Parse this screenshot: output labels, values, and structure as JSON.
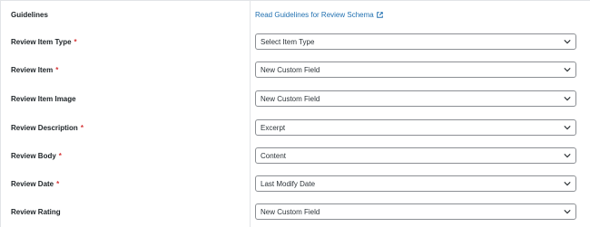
{
  "guidelines": {
    "label": "Guidelines",
    "link_text": "Read Guidelines for Review Schema",
    "link_icon": "external-link-icon"
  },
  "fields": [
    {
      "label": "Review Item Type",
      "required": true,
      "value": "Select Item Type"
    },
    {
      "label": "Review Item",
      "required": true,
      "value": "New Custom Field"
    },
    {
      "label": "Review Item Image",
      "required": false,
      "value": "New Custom Field"
    },
    {
      "label": "Review Description",
      "required": true,
      "value": "Excerpt"
    },
    {
      "label": "Review Body",
      "required": true,
      "value": "Content"
    },
    {
      "label": "Review Date",
      "required": true,
      "value": "Last Modify Date"
    },
    {
      "label": "Review Rating",
      "required": false,
      "value": "New Custom Field"
    }
  ],
  "required_marker": "*",
  "colors": {
    "link": "#2271b1",
    "required": "#d63638",
    "border": "#8c8f94",
    "divider": "#e2e4e7"
  }
}
